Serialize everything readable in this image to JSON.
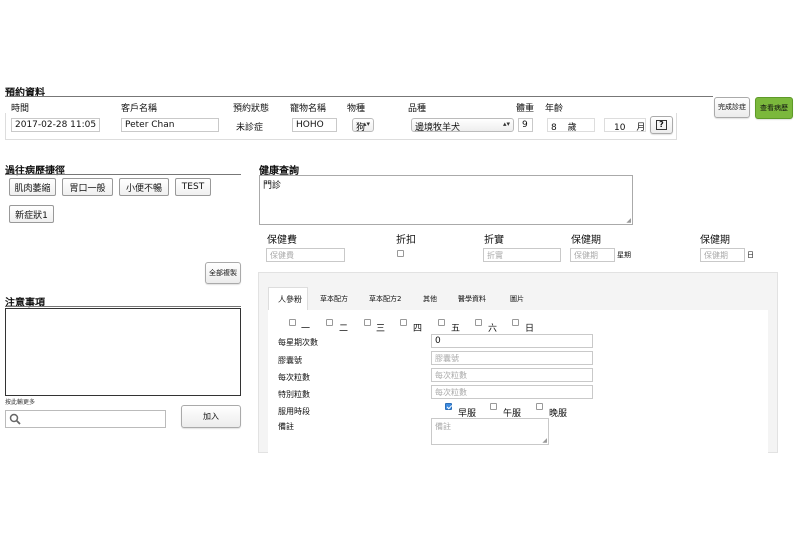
{
  "appointment": {
    "title": "預約資料",
    "headers": {
      "time": "時間",
      "client_name": "客戶名稱",
      "status": "預約狀態",
      "pet_name": "寵物名稱",
      "species": "物種",
      "breed": "品種",
      "weight": "體重",
      "age": "年齡"
    },
    "values": {
      "time": "2017-02-28 11:05",
      "client_name": "Peter Chan",
      "status": "未診症",
      "pet_name": "HOHO",
      "species": "狗",
      "breed": "邊境牧羊犬",
      "weight": "9",
      "age_years": "8",
      "age_years_unit": "歲",
      "age_months": "10",
      "age_months_unit": "月"
    },
    "help_button": "?",
    "complete_button": "完成診症",
    "view_records_button": "查看病歷"
  },
  "past_history": {
    "title": "過往病歷捷徑",
    "tags": [
      "肌肉萎縮",
      "胃口一般",
      "小便不暢",
      "TEST",
      "新症狀1"
    ],
    "copy_all_button": "全部複製"
  },
  "notes": {
    "title": "注意事項",
    "hint": "按此輸更多",
    "add_button": "加入"
  },
  "health_inquiry": {
    "title": "健康查詢",
    "text": "門診"
  },
  "fees": {
    "health_fee_label": "保健費",
    "health_fee_placeholder": "保健費",
    "discount_label": "折扣",
    "net_label": "折實",
    "net_placeholder": "折實",
    "period_label": "保健期",
    "period_placeholder": "保健期",
    "period_unit": "星期",
    "period2_label": "保健期",
    "period2_placeholder": "保健期",
    "period2_unit": "日"
  },
  "tabs": {
    "items": [
      "人參粉",
      "草本配方",
      "草本配方2",
      "其他",
      "醫學資料",
      "圖片"
    ]
  },
  "ginseng": {
    "days": [
      "一",
      "二",
      "三",
      "四",
      "五",
      "六",
      "日"
    ],
    "weekly_label": "每星期次數",
    "weekly_value": "0",
    "capsule_label": "膠囊號",
    "capsule_placeholder": "膠囊號",
    "per_dose_label": "每次粒數",
    "per_dose_placeholder": "每次粒數",
    "special_label": "特別粒數",
    "special_placeholder": "每次粒數",
    "timing_label": "服用時段",
    "timing_options": [
      "早服",
      "午服",
      "晚服"
    ],
    "remarks_label": "備註",
    "remarks_placeholder": "備註"
  },
  "colors": {
    "accent_green": "#7bb83c",
    "checkbox_blue": "#3d8be0"
  }
}
